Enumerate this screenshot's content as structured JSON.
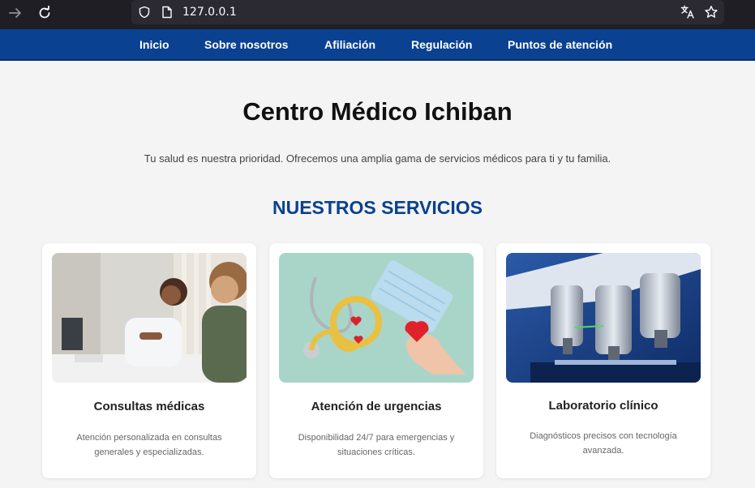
{
  "browser": {
    "url": "127.0.0.1",
    "icons": [
      "forward-arrow-icon",
      "reload-icon",
      "shield-icon",
      "page-icon",
      "translate-icon",
      "star-icon"
    ]
  },
  "nav": {
    "items": [
      {
        "label": "Inicio"
      },
      {
        "label": "Sobre nosotros"
      },
      {
        "label": "Afiliación"
      },
      {
        "label": "Regulación"
      },
      {
        "label": "Puntos de atención"
      }
    ]
  },
  "hero": {
    "title": "Centro Médico Ichiban",
    "subtitle": "Tu salud es nuestra prioridad. Ofrecemos una amplia gama de servicios médicos para ti y tu familia."
  },
  "services": {
    "heading": "NUESTROS SERVICIOS",
    "cards": [
      {
        "title": "Consultas médicas",
        "description": "Atención personalizada en consultas generales y especializadas."
      },
      {
        "title": "Atención de urgencias",
        "description": "Disponibilidad 24/7 para emergencias y situaciones críticas."
      },
      {
        "title": "Laboratorio clínico",
        "description": "Diagnósticos precisos con tecnología avanzada."
      }
    ]
  },
  "colors": {
    "nav_bg": "#0a4190",
    "accent": "#0a4190",
    "page_bg": "#f4f4f4"
  }
}
